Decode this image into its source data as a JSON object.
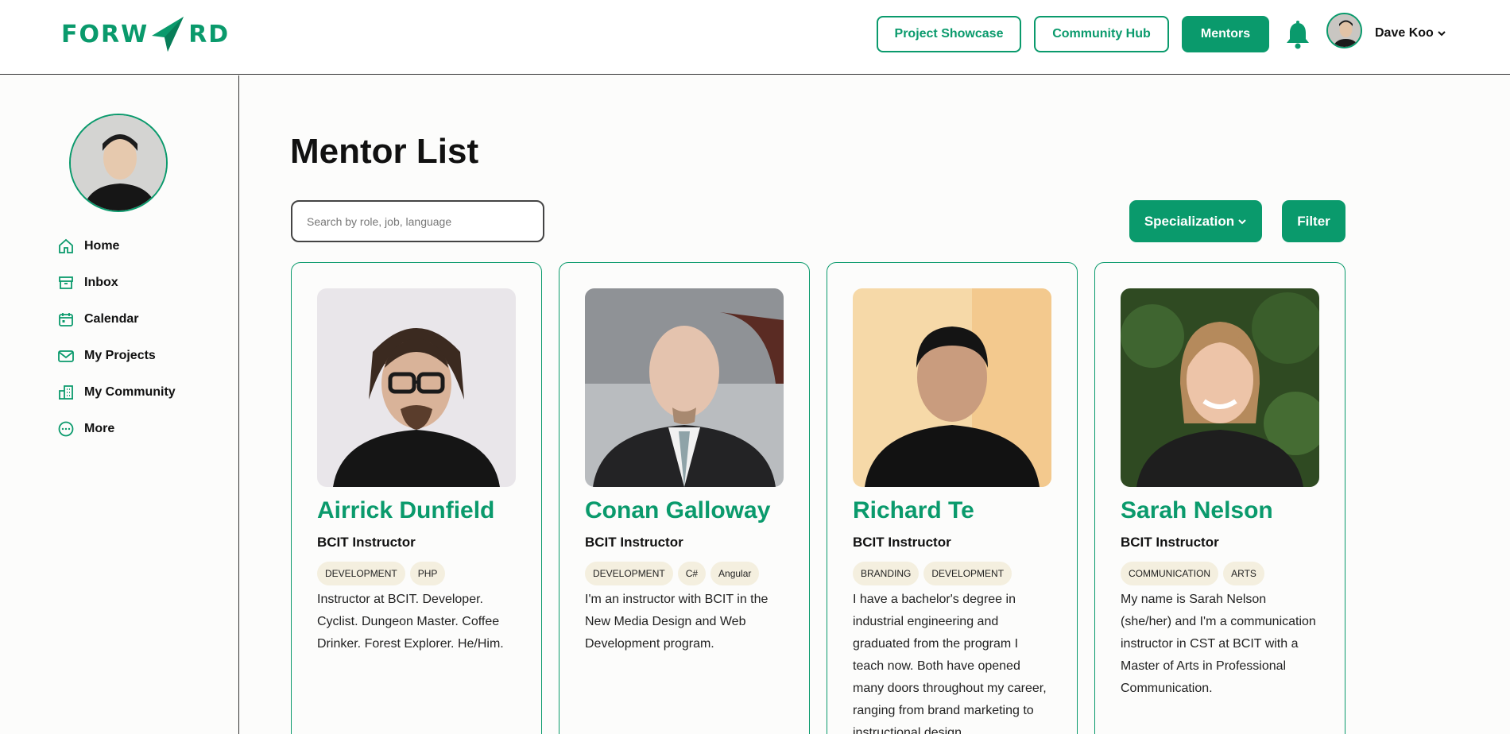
{
  "header": {
    "logo_left": "FORW",
    "logo_right": "RD",
    "nav": [
      {
        "label": "Project Showcase"
      },
      {
        "label": "Community Hub"
      },
      {
        "label": "Mentors"
      }
    ],
    "user_name": "Dave Koo"
  },
  "sidebar": {
    "items": [
      {
        "label": "Home",
        "icon": "home-icon"
      },
      {
        "label": "Inbox",
        "icon": "inbox-icon"
      },
      {
        "label": "Calendar",
        "icon": "calendar-icon"
      },
      {
        "label": "My Projects",
        "icon": "mail-icon"
      },
      {
        "label": "My Community",
        "icon": "buildings-icon"
      },
      {
        "label": "More",
        "icon": "more-icon"
      }
    ]
  },
  "main": {
    "title": "Mentor List",
    "search_placeholder": "Search by role, job, language",
    "specialization_label": "Specialization",
    "filter_label": "Filter",
    "mentors": [
      {
        "name": "Airrick Dunfield",
        "role": "BCIT Instructor",
        "tags": [
          "DEVELOPMENT",
          "PHP"
        ],
        "bio": "Instructor at BCIT. Developer. Cyclist. Dungeon Master. Coffee Drinker. Forest Explorer. He/Him."
      },
      {
        "name": "Conan Galloway",
        "role": "BCIT Instructor",
        "tags": [
          "DEVELOPMENT",
          "C#",
          "Angular"
        ],
        "bio": "I'm an instructor with BCIT in the New Media Design and Web Development program."
      },
      {
        "name": "Richard Te",
        "role": "BCIT Instructor",
        "tags": [
          "BRANDING",
          "DEVELOPMENT"
        ],
        "bio": "I have a bachelor's degree in industrial engineering and graduated from the program I teach now. Both have opened many doors throughout my career, ranging from brand marketing to instructional design."
      },
      {
        "name": "Sarah Nelson",
        "role": "BCIT Instructor",
        "tags": [
          "COMMUNICATION",
          "ARTS"
        ],
        "bio": "My name is Sarah Nelson (she/her) and I'm a communication instructor in CST at BCIT with a Master of Arts in Professional Communication."
      }
    ]
  },
  "colors": {
    "brand": "#0a9a6c",
    "tag_bg": "#f4efdf"
  }
}
